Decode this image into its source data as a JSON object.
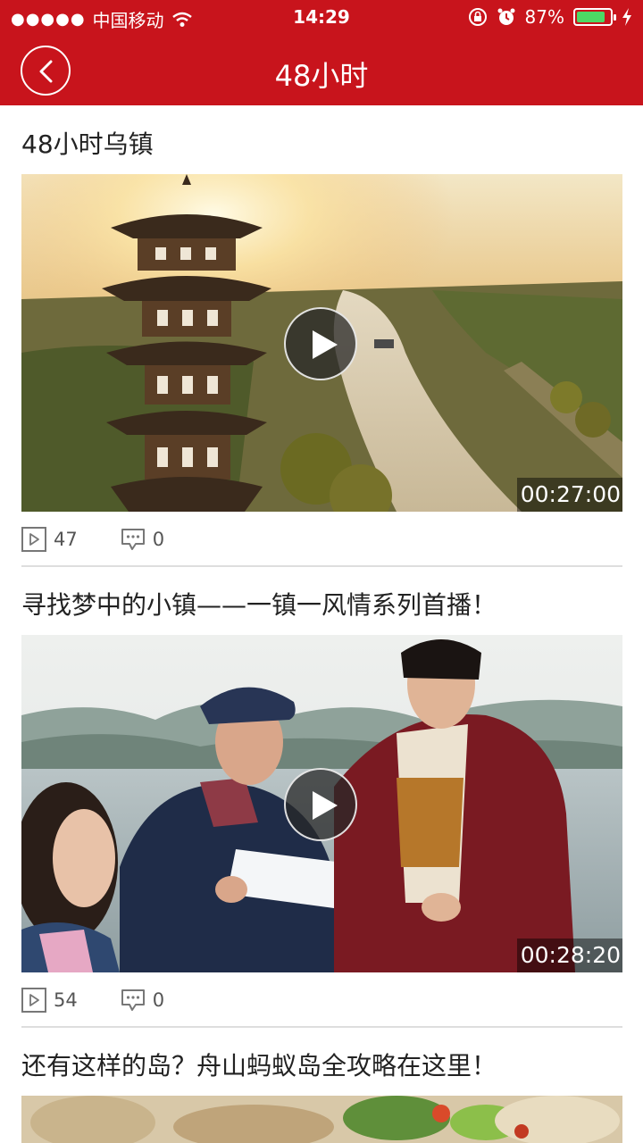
{
  "status_bar": {
    "carrier": "中国移动",
    "time": "14:29",
    "battery": "87%",
    "battery_level": 0.87
  },
  "nav": {
    "title": "48小时",
    "back_icon": "chevron-left-icon"
  },
  "feed": [
    {
      "title": "48小时乌镇",
      "duration": "00:27:00",
      "plays": "47",
      "comments": "0",
      "thumbnail": "pagoda-river-sunset"
    },
    {
      "title": "寻找梦中的小镇——一镇一风情系列首播！",
      "duration": "00:28:20",
      "plays": "54",
      "comments": "0",
      "thumbnail": "lakeside-interview"
    },
    {
      "title": "还有这样的岛？舟山蚂蚁岛全攻略在这里！",
      "thumbnail": "seafood-dish"
    }
  ],
  "colors": {
    "header": "#c8141c",
    "battery": "#4cd964"
  }
}
